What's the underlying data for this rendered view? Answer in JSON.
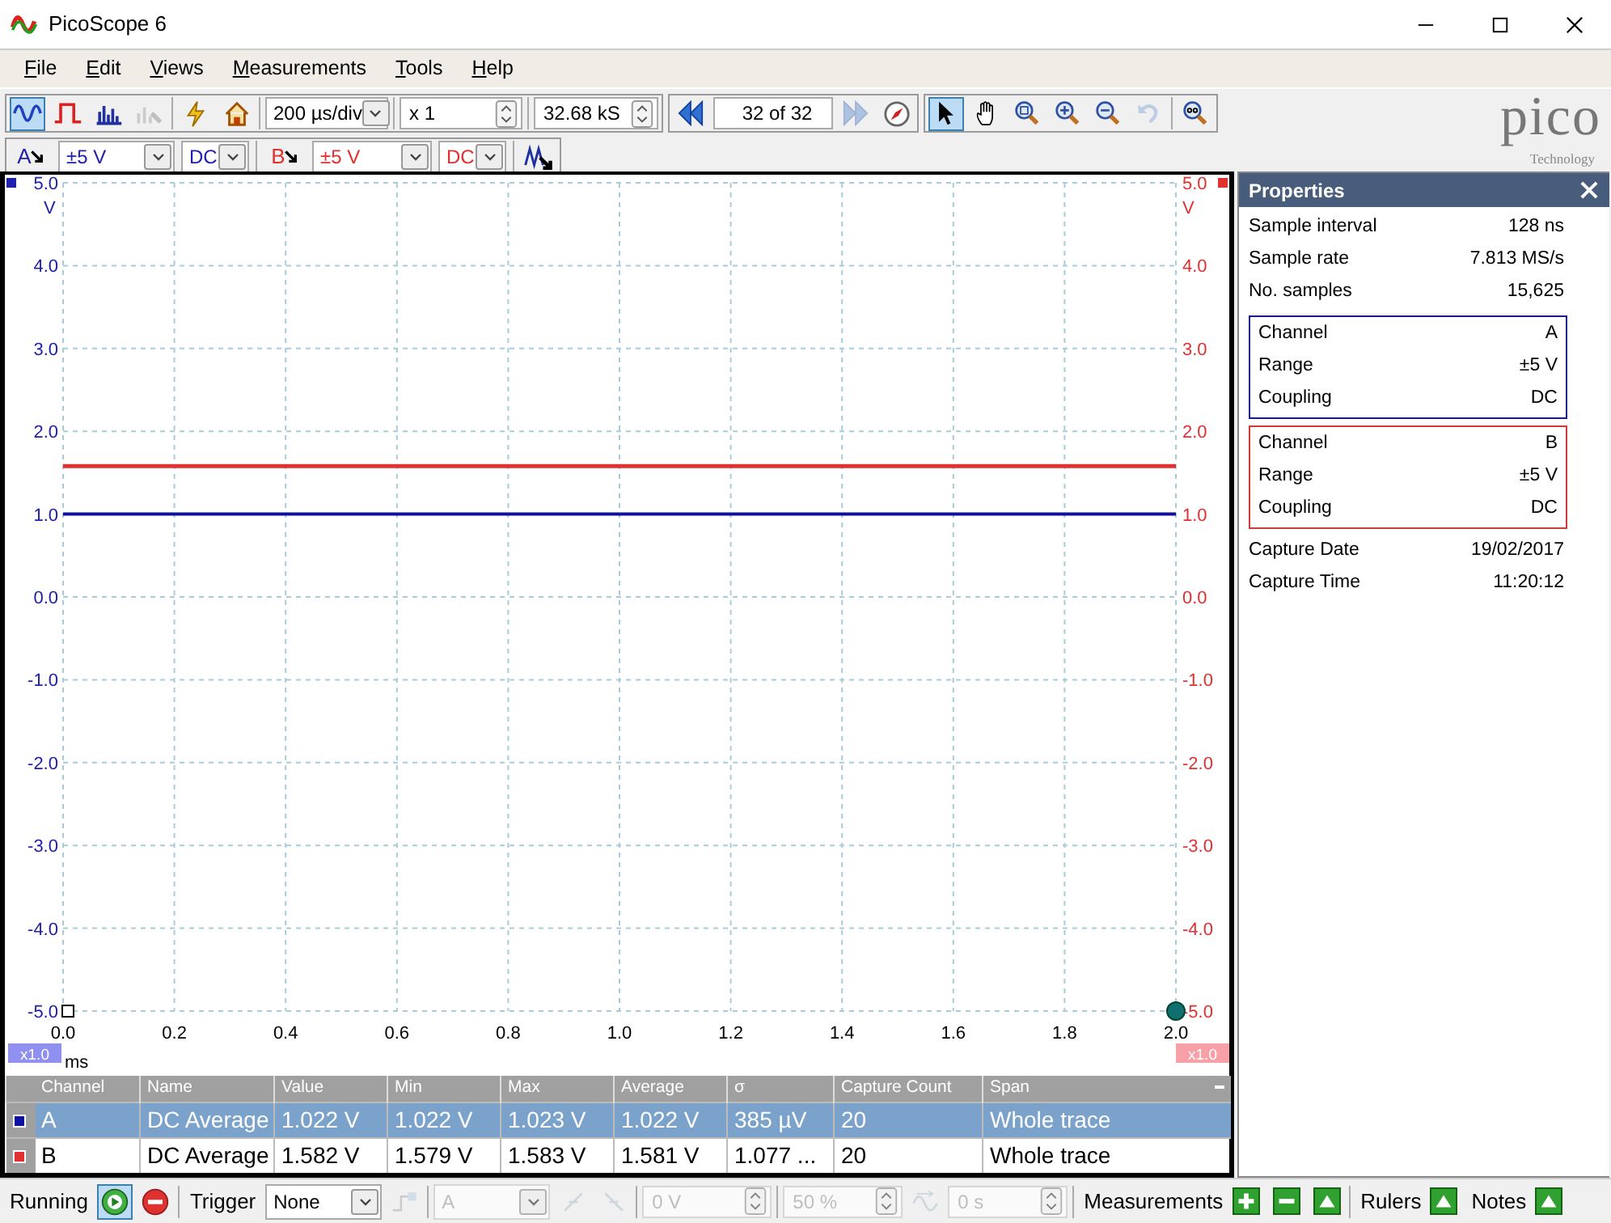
{
  "window": {
    "title": "PicoScope 6"
  },
  "menu": [
    {
      "label": "File"
    },
    {
      "label": "Edit"
    },
    {
      "label": "Views"
    },
    {
      "label": "Measurements"
    },
    {
      "label": "Tools"
    },
    {
      "label": "Help"
    }
  ],
  "toolbar": {
    "view_buttons": [
      {
        "kind": "scope",
        "selected": true,
        "disabled": false
      },
      {
        "kind": "persistence",
        "selected": false,
        "disabled": false
      },
      {
        "kind": "spectrum",
        "selected": false,
        "disabled": false
      },
      {
        "kind": "xy",
        "selected": false,
        "disabled": true
      }
    ],
    "timebase": "200 µs/div",
    "zoom": "x 1",
    "samples": "32.68 kS",
    "nav": [
      {
        "kind": "back",
        "disabled": false
      },
      {
        "kind": "forward",
        "disabled": true
      }
    ],
    "buffer": "32 of 32",
    "tools": [
      {
        "kind": "pointer",
        "selected": true,
        "disabled": false
      },
      {
        "kind": "hand",
        "selected": false,
        "disabled": false
      },
      {
        "kind": "zoom-fit",
        "selected": false,
        "disabled": false
      },
      {
        "kind": "zoom-in",
        "selected": false,
        "disabled": false
      },
      {
        "kind": "zoom-out",
        "selected": false,
        "disabled": false
      },
      {
        "kind": "undo",
        "selected": false,
        "disabled": true
      },
      {
        "kind": "zoom-100",
        "selected": false,
        "disabled": false
      }
    ]
  },
  "channels_bar": [
    {
      "label": "A",
      "color": "#2020b0",
      "range": "±5 V",
      "coupling": "DC"
    },
    {
      "label": "B",
      "color": "#e03030",
      "range": "±5 V",
      "coupling": "DC"
    }
  ],
  "logo": {
    "name": "pico",
    "tagline": "Technology"
  },
  "scope": {
    "chart_data": {
      "type": "line",
      "xlabel": "ms",
      "ylabel": "V",
      "x": [
        0.0,
        2.0
      ],
      "xlim": [
        0,
        2
      ],
      "ylim": [
        -5,
        5
      ],
      "xticks": [
        {
          "value": 0,
          "label": "0.0"
        },
        {
          "value": 0.2,
          "label": "0.2"
        },
        {
          "value": 0.4,
          "label": "0.4"
        },
        {
          "value": 0.6,
          "label": "0.6"
        },
        {
          "value": 0.8,
          "label": "0.8"
        },
        {
          "value": 1.0,
          "label": "1.0"
        },
        {
          "value": 1.2,
          "label": "1.2"
        },
        {
          "value": 1.4,
          "label": "1.4"
        },
        {
          "value": 1.6,
          "label": "1.6"
        },
        {
          "value": 1.8,
          "label": "1.8"
        },
        {
          "value": 2.0,
          "label": "2.0"
        }
      ],
      "yticks": [
        {
          "value": 5,
          "label": "5.0"
        },
        {
          "value": 4,
          "label": "4.0"
        },
        {
          "value": 3,
          "label": "3.0"
        },
        {
          "value": 2,
          "label": "2.0"
        },
        {
          "value": 1,
          "label": "1.0"
        },
        {
          "value": 0,
          "label": "0.0"
        },
        {
          "value": -1,
          "label": "-1.0"
        },
        {
          "value": -2,
          "label": "-2.0"
        },
        {
          "value": -3,
          "label": "-3.0"
        },
        {
          "value": -4,
          "label": "-4.0"
        },
        {
          "value": -5,
          "label": "-5.0"
        }
      ],
      "grid": true,
      "series": [
        {
          "color": "#1010a0",
          "values": [
            1.0,
            1.0
          ]
        },
        {
          "color": "#e03030",
          "values": [
            1.58,
            1.58
          ]
        }
      ]
    },
    "right_axis": {
      "unit": "V",
      "ticks": [
        "5.0",
        "4.0",
        "3.0",
        "2.0",
        "1.0",
        "0.0",
        "-1.0",
        "-2.0",
        "-3.0",
        "-4.0",
        "-5.0"
      ]
    },
    "scale_left": "x1.0",
    "scale_right": "x1.0"
  },
  "measurements": {
    "columns": [
      "Channel",
      "Name",
      "Value",
      "Min",
      "Max",
      "Average",
      "σ",
      "Capture Count",
      "Span"
    ],
    "rows": [
      {
        "color": "#1010a0",
        "selected": true,
        "cells": [
          "A",
          "DC Average",
          "1.022 V",
          "1.022 V",
          "1.023 V",
          "1.022 V",
          "385 µV",
          "20",
          "Whole trace"
        ]
      },
      {
        "color": "#e03030",
        "selected": false,
        "cells": [
          "B",
          "DC Average",
          "1.582 V",
          "1.579 V",
          "1.583 V",
          "1.581 V",
          "1.077 ...",
          "20",
          "Whole trace"
        ]
      }
    ]
  },
  "properties": {
    "title": "Properties",
    "general": [
      {
        "label": "Sample interval",
        "value": "128 ns"
      },
      {
        "label": "Sample rate",
        "value": "7.813 MS/s"
      },
      {
        "label": "No. samples",
        "value": "15,625"
      }
    ],
    "channels": [
      {
        "color": "#1a1a90",
        "rows": [
          {
            "label": "Channel",
            "value": "A"
          },
          {
            "label": "Range",
            "value": "±5 V"
          },
          {
            "label": "Coupling",
            "value": "DC"
          }
        ]
      },
      {
        "color": "#d03a3a",
        "rows": [
          {
            "label": "Channel",
            "value": "B"
          },
          {
            "label": "Range",
            "value": "±5 V"
          },
          {
            "label": "Coupling",
            "value": "DC"
          }
        ]
      }
    ],
    "capture": [
      {
        "label": "Capture Date",
        "value": "19/02/2017"
      },
      {
        "label": "Capture Time",
        "value": "11:20:12"
      }
    ]
  },
  "status_bar": {
    "run_state": "Running",
    "running": true,
    "trigger_label": "Trigger",
    "trigger_mode": "None",
    "trigger_disabled": true,
    "trigger_source": "A",
    "threshold": "0 V",
    "pretrigger": "50 %",
    "delay": "0 s",
    "measurements_label": "Measurements",
    "rulers_label": "Rulers",
    "notes_label": "Notes"
  }
}
